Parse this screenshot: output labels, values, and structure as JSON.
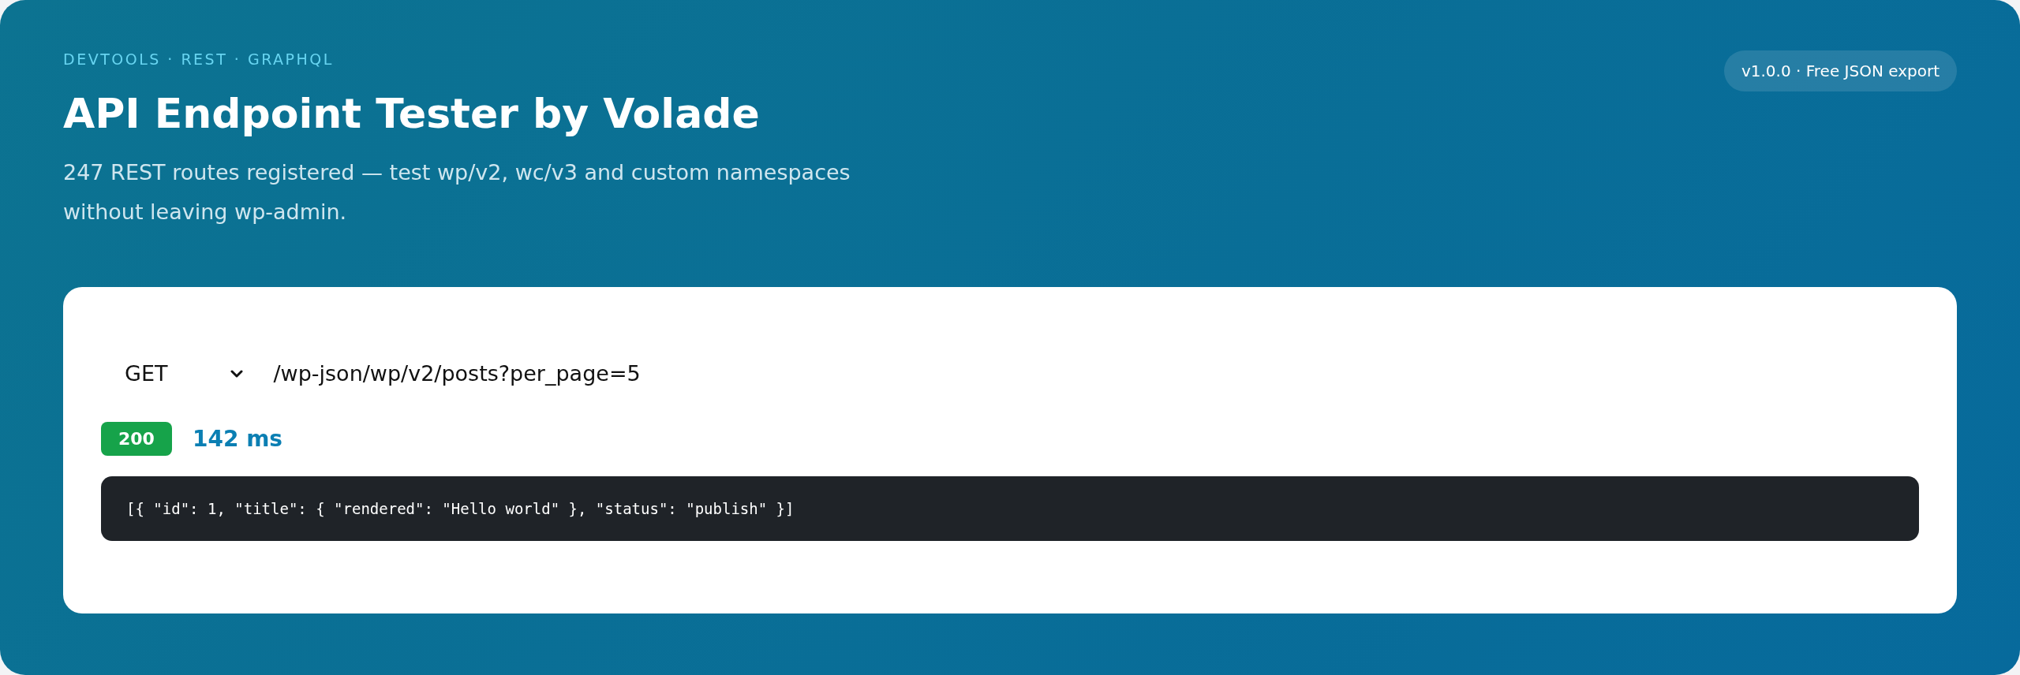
{
  "header": {
    "eyebrow": "DEVTOOLS · REST · GRAPHQL",
    "title": "API Endpoint Tester by Volade",
    "subtitle": "247 REST routes registered — test wp/v2, wc/v3 and custom namespaces without leaving wp-admin.",
    "badge": "v1.0.0 · Free JSON export"
  },
  "request": {
    "method": "GET",
    "url": "/wp-json/wp/v2/posts?per_page=5"
  },
  "response": {
    "status": "200",
    "time": "142 ms",
    "body": "[{ \"id\": 1, \"title\": { \"rendered\": \"Hello world\" }, \"status\": \"publish\" }]"
  }
}
